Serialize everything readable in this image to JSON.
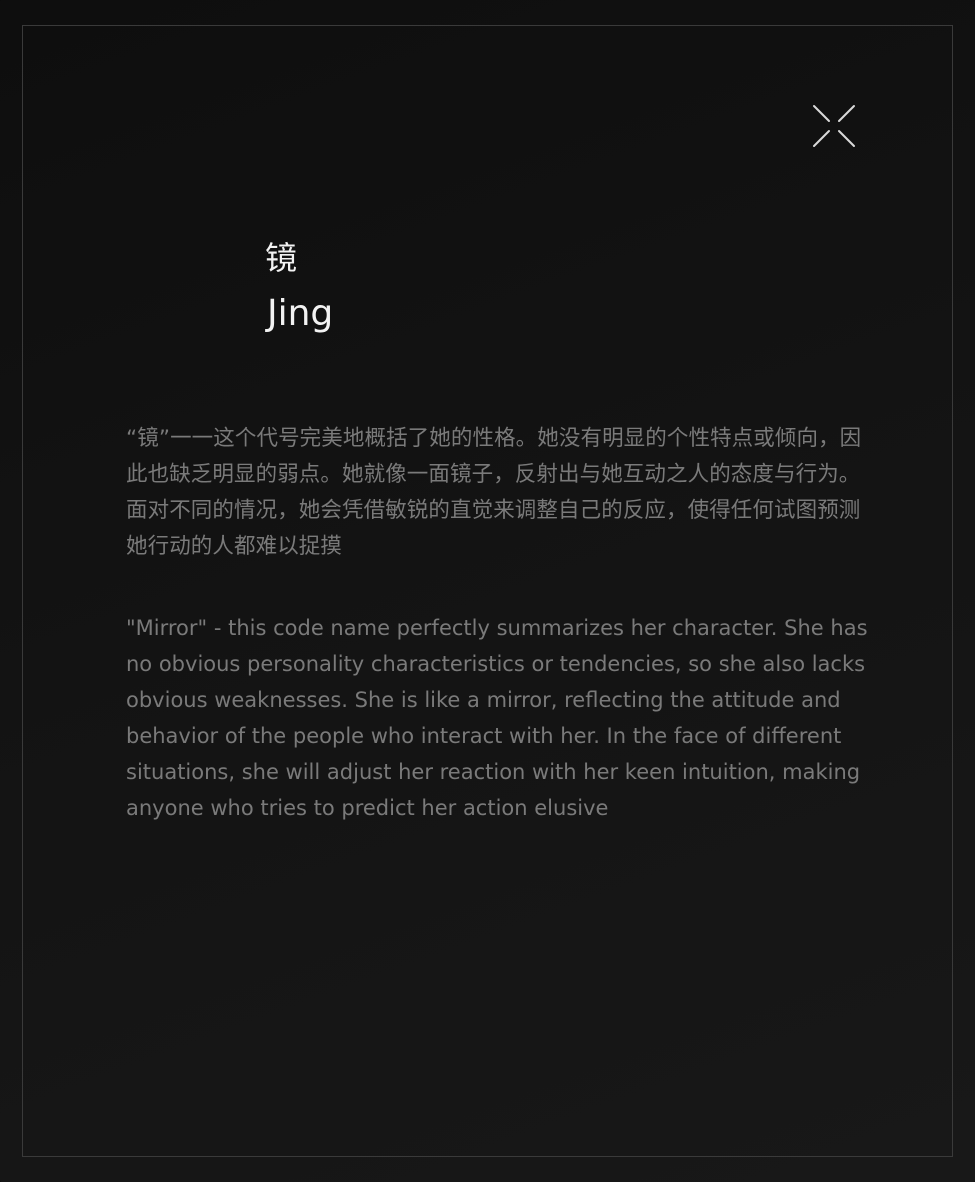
{
  "card": {
    "title_cn": "镜",
    "title_en": "Jing",
    "description_cn": "“镜”一一这个代号完美地概括了她的性格。她没有明显的个性特点或倾向，因此也缺乏明显的弱点。她就像一面镜子，反射出与她互动之人的态度与行为。面对不同的情况，她会凭借敏锐的直觉来调整自己的反应，使得任何试图预测她行动的人都难以捉摸",
    "description_en": "\"Mirror\" - this code name perfectly summarizes her character. She has no obvious personality characteristics or tendencies, so she also lacks obvious weaknesses. She is like a mirror, reflecting the attitude and behavior of the people who interact with her. In the face of different situations, she will adjust her reaction with her keen intuition, making anyone who tries to predict her action elusive"
  },
  "controls": {
    "close_icon": "close-icon"
  },
  "colors": {
    "background": "#111111",
    "frame_border": "#3a3a3a",
    "title_text": "#f2f2f2",
    "body_text": "#7a7a7a",
    "icon": "#d9d9d9"
  }
}
